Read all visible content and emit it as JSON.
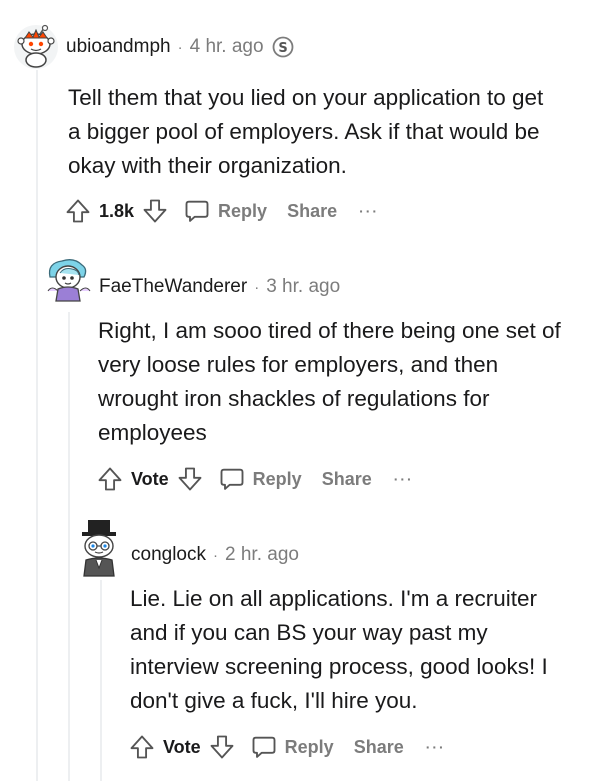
{
  "comments": [
    {
      "username": "ubioandmph",
      "separator": "·",
      "time": "4 hr. ago",
      "badge": "S",
      "body": [
        "Tell them that you lied on your application to get",
        "a bigger pool of employers. Ask if that would be",
        "okay with their organization."
      ],
      "vote_label": "1.8k",
      "reply_label": "Reply",
      "share_label": "Share",
      "more_label": "···"
    },
    {
      "username": "FaeTheWanderer",
      "separator": "·",
      "time": "3 hr. ago",
      "body": [
        "Right, I am sooo tired of there being one set of",
        "very loose rules for employers, and then",
        "wrought iron shackles of regulations for",
        "employees"
      ],
      "vote_label": "Vote",
      "reply_label": "Reply",
      "share_label": "Share",
      "more_label": "···"
    },
    {
      "username": "conglock",
      "separator": "·",
      "time": "2 hr. ago",
      "body": [
        "Lie. Lie on all applications. I'm a recruiter",
        "and if you can BS your way past my",
        "interview screening process, good looks! I",
        "don't give a fuck, I'll hire you."
      ],
      "vote_label": "Vote",
      "reply_label": "Reply",
      "share_label": "Share",
      "more_label": "···"
    }
  ],
  "colors": {
    "meta_gray": "#7c7c7c",
    "thread_line": "#edeff1",
    "text": "#1a1a1b"
  }
}
